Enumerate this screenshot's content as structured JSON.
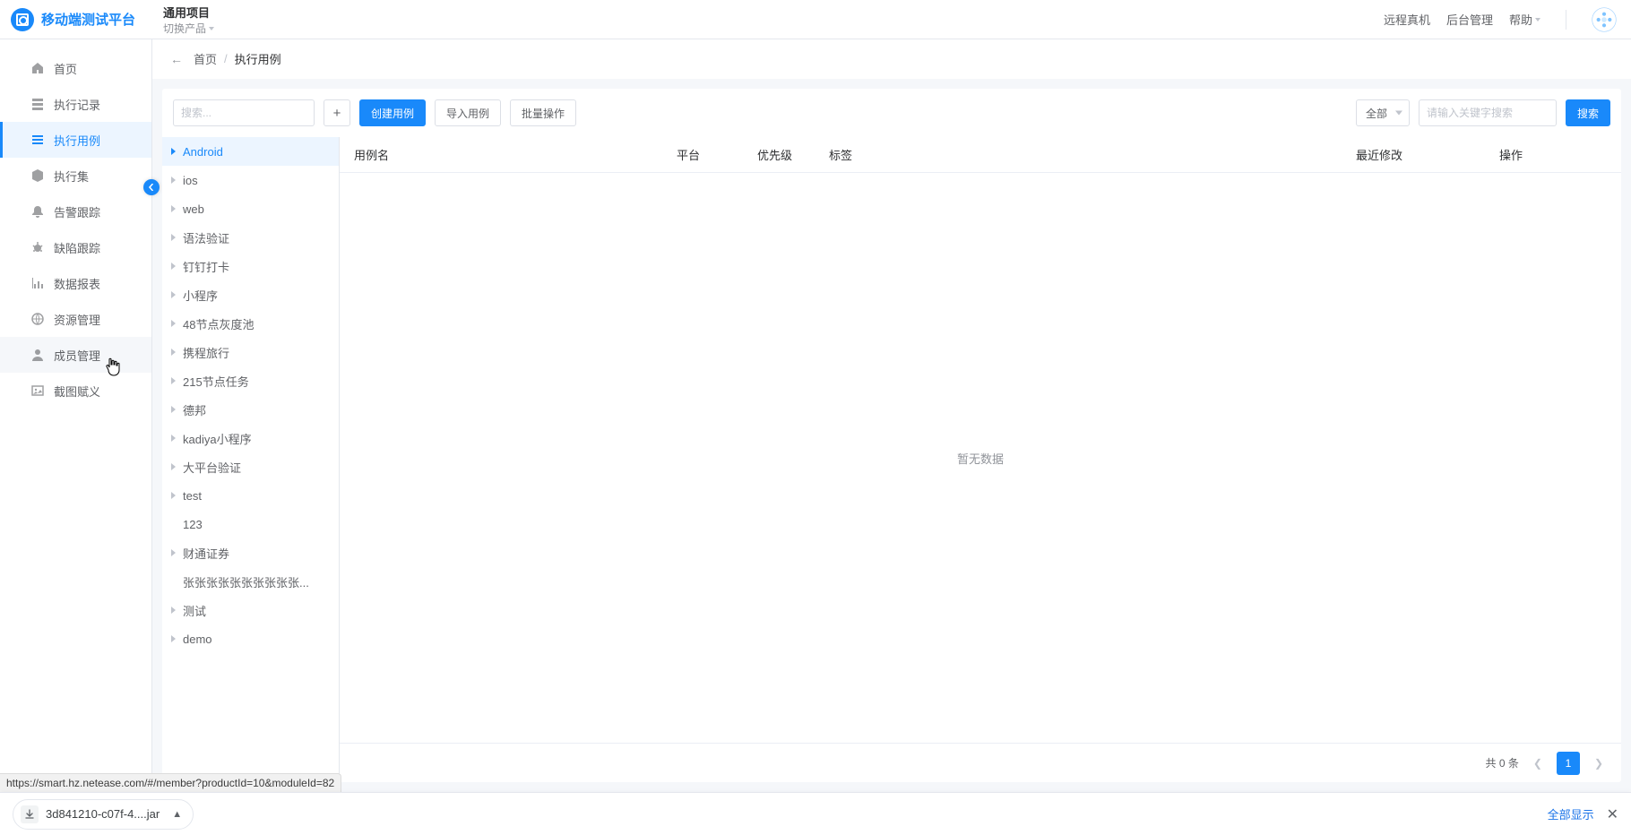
{
  "header": {
    "logo_text": "移动端测试平台",
    "project_title": "通用项目",
    "switch_product": "切换产品",
    "links": {
      "remote": "远程真机",
      "admin": "后台管理",
      "help": "帮助"
    }
  },
  "sidebar": {
    "items": [
      {
        "key": "home",
        "label": "首页",
        "icon": "home-icon"
      },
      {
        "key": "exec-log",
        "label": "执行记录",
        "icon": "list-icon"
      },
      {
        "key": "exec-case",
        "label": "执行用例",
        "icon": "menu-icon",
        "active": true
      },
      {
        "key": "exec-set",
        "label": "执行集",
        "icon": "cube-icon"
      },
      {
        "key": "alarm",
        "label": "告警跟踪",
        "icon": "bell-icon"
      },
      {
        "key": "bug",
        "label": "缺陷跟踪",
        "icon": "bug-icon"
      },
      {
        "key": "report",
        "label": "数据报表",
        "icon": "chart-icon"
      },
      {
        "key": "resource",
        "label": "资源管理",
        "icon": "globe-icon"
      },
      {
        "key": "member",
        "label": "成员管理",
        "icon": "user-icon",
        "hover": true
      },
      {
        "key": "screenshot",
        "label": "截图赋义",
        "icon": "image-icon"
      }
    ]
  },
  "breadcrumb": {
    "home": "首页",
    "current": "执行用例"
  },
  "toolbar": {
    "tree_search_placeholder": "搜索...",
    "create": "创建用例",
    "import": "导入用例",
    "batch": "批量操作",
    "filter_all": "全部",
    "keyword_placeholder": "请输入关键字搜索",
    "search": "搜索"
  },
  "tree": [
    {
      "label": "Android",
      "expandable": true,
      "selected": true
    },
    {
      "label": "ios",
      "expandable": true
    },
    {
      "label": "web",
      "expandable": true
    },
    {
      "label": "语法验证",
      "expandable": true
    },
    {
      "label": "钉钉打卡",
      "expandable": true
    },
    {
      "label": "小程序",
      "expandable": true
    },
    {
      "label": "48节点灰度池",
      "expandable": true
    },
    {
      "label": "携程旅行",
      "expandable": true
    },
    {
      "label": "215节点任务",
      "expandable": true
    },
    {
      "label": "德邦",
      "expandable": true
    },
    {
      "label": "kadiya小程序",
      "expandable": true
    },
    {
      "label": "大平台验证",
      "expandable": true
    },
    {
      "label": "test",
      "expandable": true
    },
    {
      "label": "123",
      "expandable": false
    },
    {
      "label": "财通证券",
      "expandable": true
    },
    {
      "label": "张张张张张张张张张张...",
      "expandable": false
    },
    {
      "label": "测试",
      "expandable": true
    },
    {
      "label": "demo",
      "expandable": true
    }
  ],
  "table": {
    "columns": {
      "name": "用例名",
      "platform": "平台",
      "priority": "优先级",
      "tag": "标签",
      "modified": "最近修改",
      "ops": "操作"
    },
    "empty": "暂无数据",
    "total": "共 0 条",
    "page": "1"
  },
  "status_url": "https://smart.hz.netease.com/#/member?productId=10&moduleId=82",
  "download": {
    "filename": "3d841210-c07f-4....jar",
    "show_all": "全部显示"
  }
}
